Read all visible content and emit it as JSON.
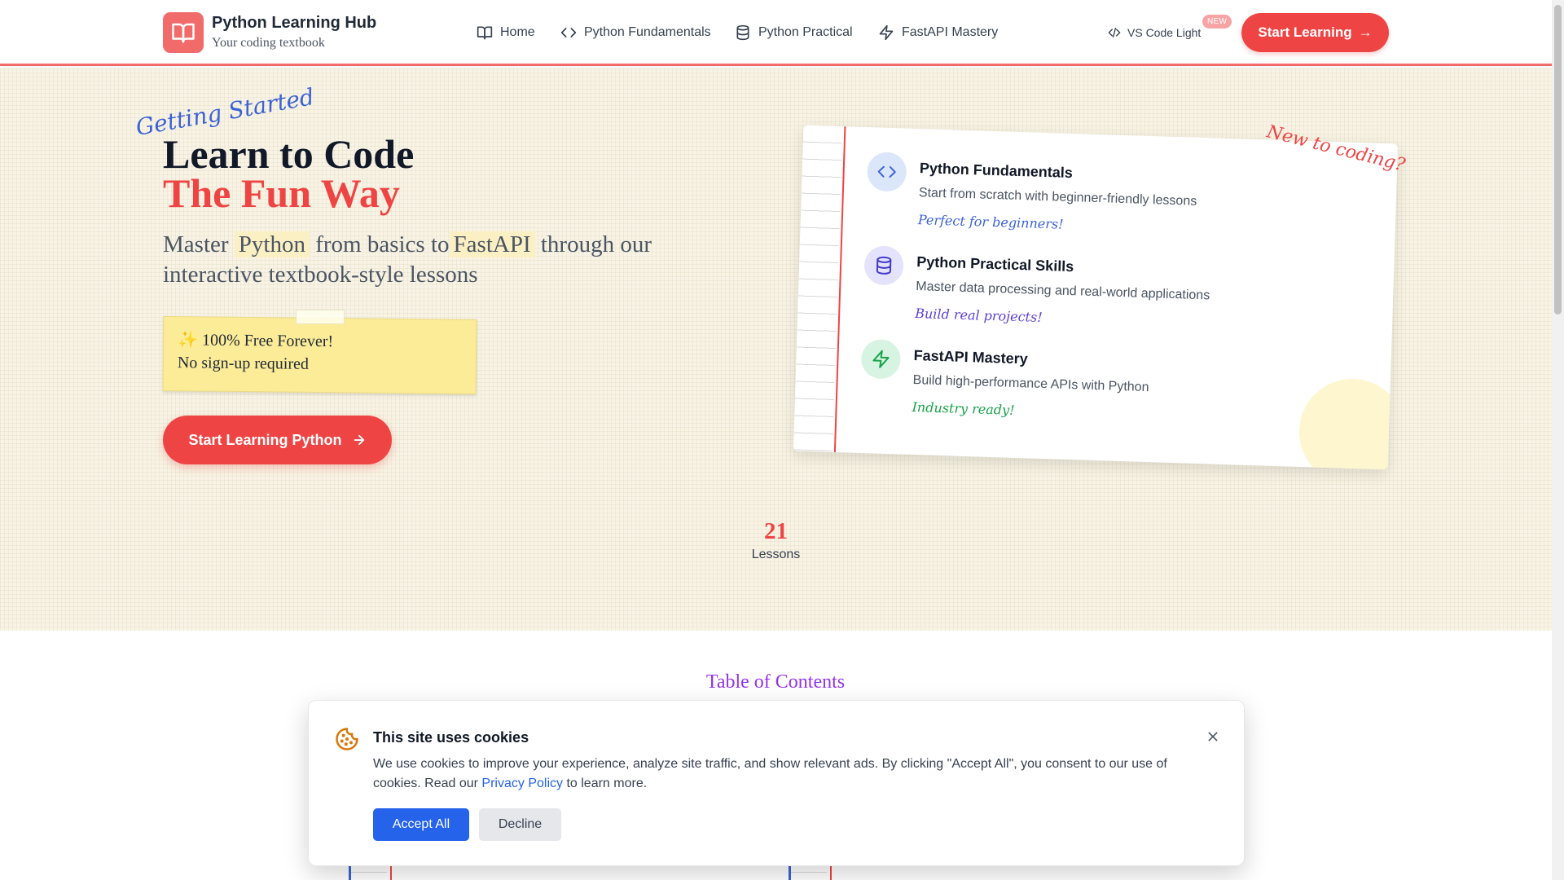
{
  "header": {
    "brand_title": "Python Learning Hub",
    "brand_subtitle": "Your coding textbook",
    "logo_icon": "open-book-icon",
    "nav": [
      {
        "label": "Home",
        "icon": "book-icon"
      },
      {
        "label": "Python Fundamentals",
        "icon": "code-icon"
      },
      {
        "label": "Python Practical",
        "icon": "database-icon"
      },
      {
        "label": "FastAPI Mastery",
        "icon": "lightning-icon"
      }
    ],
    "theme_label": "VS Code Light",
    "theme_badge": "NEW",
    "cta_label": "Start Learning",
    "cta_arrow": "→"
  },
  "hero": {
    "handwritten_note": "Getting Started",
    "title_line1": "Learn to Code",
    "title_line2": "The Fun Way",
    "subtitle_pre": "Master",
    "subtitle_hl1": "Python",
    "subtitle_mid": "from basics to",
    "subtitle_hl2": "FastAPI",
    "subtitle_post": "through our interactive textbook-style lessons",
    "sticky_line1": "✨ 100% Free Forever!",
    "sticky_line2": "No sign-up required",
    "cta_label": "Start Learning Python",
    "side_note": "New to coding?",
    "cards": [
      {
        "title": "Python Fundamentals",
        "description": "Start from scratch with beginner-friendly lessons",
        "tag": "Perfect for beginners!",
        "tag_color": "#3b62d6",
        "icon": "code-icon",
        "icon_bg": "#dbe6fb",
        "icon_color": "#3b62d6"
      },
      {
        "title": "Python Practical Skills",
        "description": "Master data processing and real-world applications",
        "tag": "Build real projects!",
        "tag_color": "#5b3fd6",
        "icon": "database-icon",
        "icon_bg": "#e4e3fb",
        "icon_color": "#4338ca"
      },
      {
        "title": "FastAPI Mastery",
        "description": "Build high-performance APIs with Python",
        "tag": "Industry ready!",
        "tag_color": "#16a34a",
        "icon": "lightning-icon",
        "icon_bg": "#d7f4e2",
        "icon_color": "#16a34a"
      }
    ],
    "stats": [
      {
        "value": "21",
        "label": "Lessons"
      }
    ]
  },
  "toc": {
    "title": "Table of Contents"
  },
  "cookie": {
    "title": "This site uses cookies",
    "text_pre": "We use cookies to improve your experience, analyze site traffic, and show relevant ads. By clicking \"Accept All\", you consent to our use of cookies. Read our",
    "link_label": "Privacy Policy",
    "text_post": "to learn more.",
    "accept_label": "Accept All",
    "decline_label": "Decline",
    "icon": "cookie-icon",
    "close_icon": "close-icon"
  },
  "colors": {
    "accent": "#ef4444",
    "link": "#2563eb",
    "toc_title": "#9333ea"
  }
}
